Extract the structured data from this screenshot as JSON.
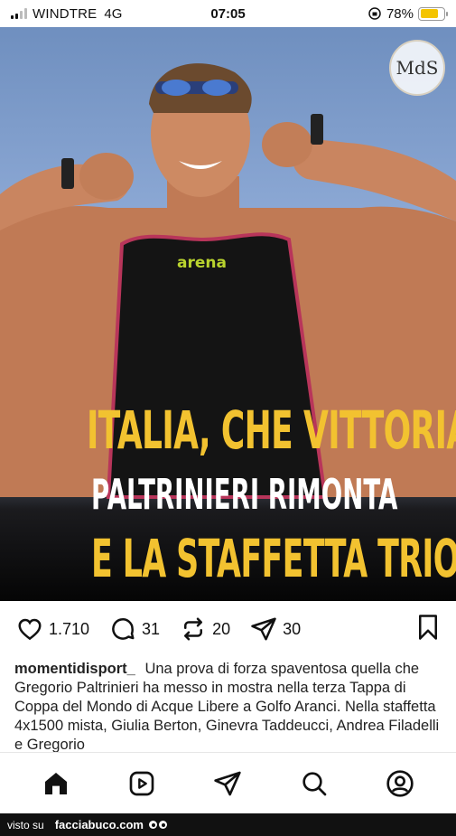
{
  "status_bar": {
    "carrier": "WINDTRE",
    "network": "4G",
    "time": "07:05",
    "battery_percent": "78%",
    "battery_level": 0.78
  },
  "post": {
    "watermark": "MdS",
    "headline_line1": "ITALIA, CHE VITTORIA!",
    "headline_line2": "PALTRINIERI RIMONTA",
    "headline_line3": "E LA STAFFETTA TRIONFA",
    "swimsuit_brand": "arena",
    "likes": "1.710",
    "comments": "31",
    "reposts": "20",
    "shares": "30",
    "username": "momentidisport_",
    "caption": "Una prova di forza spaventosa quella che Gregorio Paltrinieri ha messo in mostra nella terza Tappa di Coppa del Mondo di Acque Libere a Golfo Aranci. Nella staffetta 4x1500 mista, Giulia Berton, Ginevra Taddeucci, Andrea Filadelli e Gregorio"
  },
  "footer": {
    "visto_su": "visto su",
    "site": "facciabuco.com"
  },
  "colors": {
    "headline_yellow": "#f2c230",
    "battery_yellow": "#f4c400"
  },
  "icons": {
    "like": "heart-icon",
    "comment": "comment-icon",
    "repost": "repost-icon",
    "share": "send-icon",
    "save": "bookmark-icon",
    "nav": [
      "home-icon",
      "reels-icon",
      "send-icon",
      "search-icon",
      "profile-icon"
    ]
  }
}
